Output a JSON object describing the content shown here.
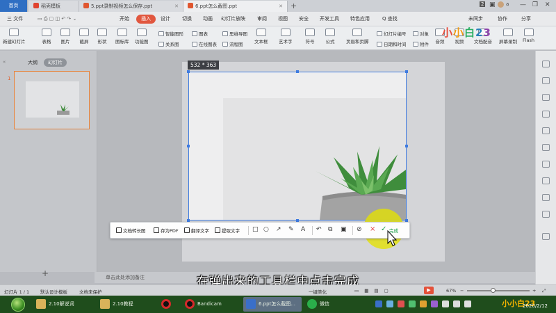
{
  "titlebar": {
    "home_tab": "首页",
    "tabs": [
      {
        "label": "稻壳模板",
        "color": "#e0432f"
      },
      {
        "label": "5.ppt录制视频怎么保存.ppt",
        "color": "#e0562f"
      },
      {
        "label": "6.ppt怎么截图.ppt",
        "color": "#e0562f"
      }
    ],
    "add_tab": "+",
    "badge": "2",
    "user": "a"
  },
  "menubar": {
    "file": "三 文件",
    "items": [
      "开始",
      "插入",
      "设计",
      "切换",
      "动画",
      "幻灯片放映",
      "审阅",
      "视图",
      "安全",
      "开发工具",
      "特色应用"
    ],
    "active": "插入",
    "search": "Q 查找",
    "sync": "未同步",
    "collab": "协作",
    "share": "分享"
  },
  "ribbon": {
    "big": [
      "新建幻灯片",
      "表格",
      "图片",
      "截屏",
      "形状",
      "图标库",
      "功能图",
      "文本框",
      "艺术字",
      "符号",
      "公式",
      "页眉和页脚",
      "音频",
      "视频",
      "文档配音",
      "屏幕录制",
      "Flash"
    ],
    "small": [
      "智能图形",
      "图表",
      "思维导图",
      "关系图",
      "在线图表",
      "流程图",
      "幻灯片编号",
      "对象",
      "日期和时间",
      "附件"
    ]
  },
  "logo": "小小白23",
  "leftpane": {
    "outline_tab": "大纲",
    "slides_tab": "幻灯片",
    "slide_number": "1",
    "add_slide": "+"
  },
  "selection": {
    "dimensions": "532 * 363"
  },
  "toolbar": {
    "long_image": "文档转长图",
    "save_pdf": "存为PDF",
    "translate": "翻译文字",
    "extract": "提取文字",
    "cancel_icon": "×",
    "done_icon": "✓",
    "done": "完成",
    "shape_icons": [
      "□",
      "○",
      "↗",
      "✎",
      "A",
      "↶",
      "⧉",
      "▣",
      "⊘"
    ]
  },
  "notes": {
    "placeholder": "单击此处添加备注"
  },
  "subtitle": "在弹出来的工具栏中点击完成",
  "statusbar": {
    "slide": "幻灯片 1 / 1",
    "theme": "默认设计模板",
    "protect": "文档未保护",
    "zoom": "67%",
    "beautify": "一键美化"
  },
  "taskbar": {
    "items": [
      {
        "label": "2.10解说词",
        "color": "#d9b35a"
      },
      {
        "label": "2.10教程",
        "color": "#d9b35a"
      },
      {
        "label": "",
        "color": "#d42a2a"
      },
      {
        "label": "Bandicam",
        "color": "#d42a2a"
      },
      {
        "label": "6.ppt怎么截图...",
        "color": "#3a6fc8"
      },
      {
        "label": "微信",
        "color": "#2aae4a"
      }
    ],
    "date": "2020/2/12",
    "tray_logo": "小小白23"
  }
}
